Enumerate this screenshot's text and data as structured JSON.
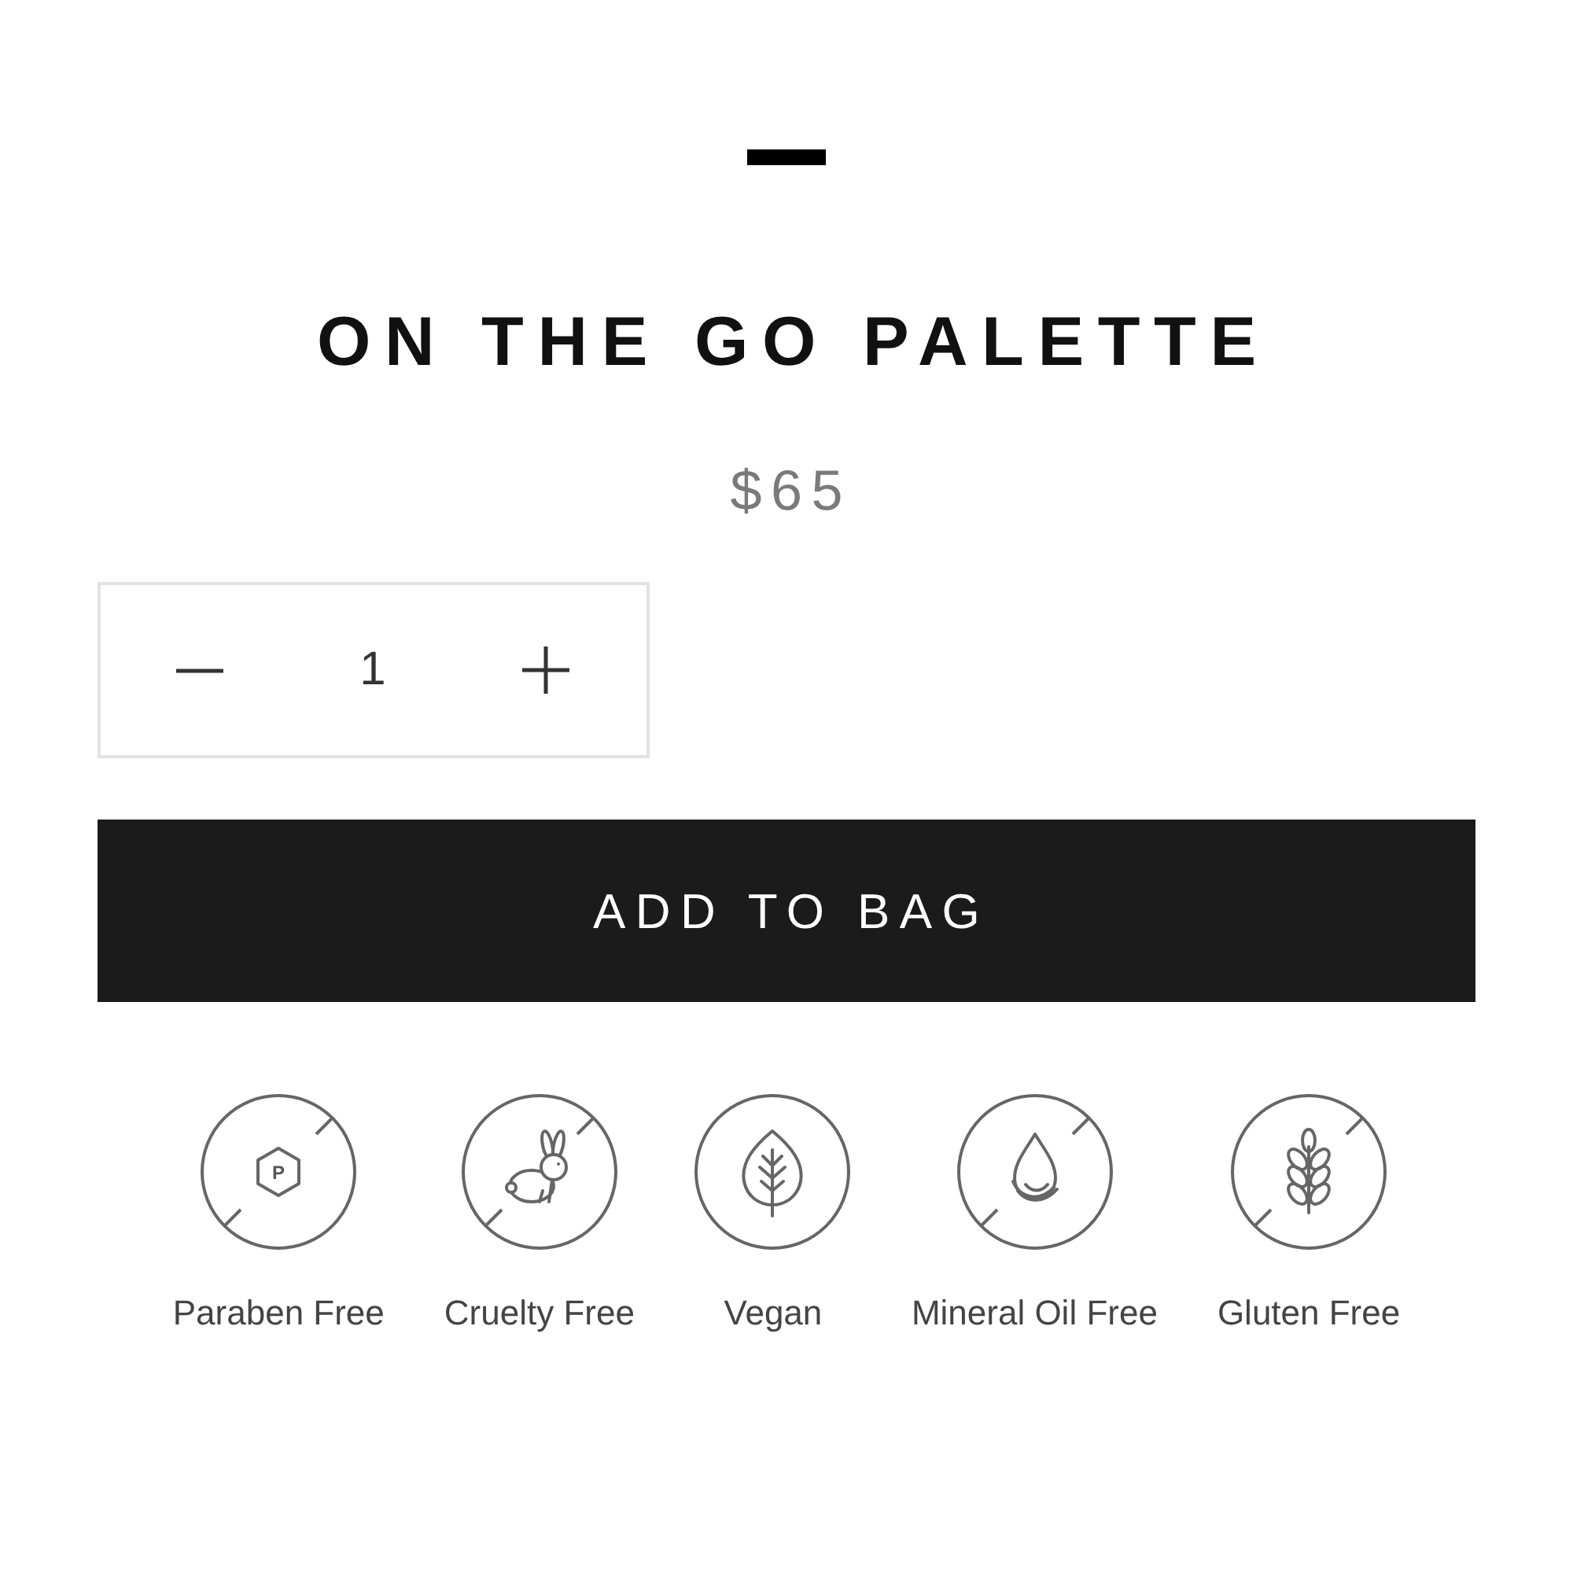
{
  "product": {
    "title": "ON THE GO PALETTE",
    "price": "$65"
  },
  "quantity": {
    "value": "1"
  },
  "add_button": {
    "label": "ADD TO BAG"
  },
  "badges": [
    {
      "label": "Paraben Free",
      "kind": "paraben",
      "symbol": "P",
      "crossed": true
    },
    {
      "label": "Cruelty Free",
      "kind": "rabbit",
      "crossed": true
    },
    {
      "label": "Vegan",
      "kind": "leaf",
      "crossed": false
    },
    {
      "label": "Mineral Oil Free",
      "kind": "drop",
      "crossed": true
    },
    {
      "label": "Gluten Free",
      "kind": "wheat",
      "crossed": true
    }
  ]
}
